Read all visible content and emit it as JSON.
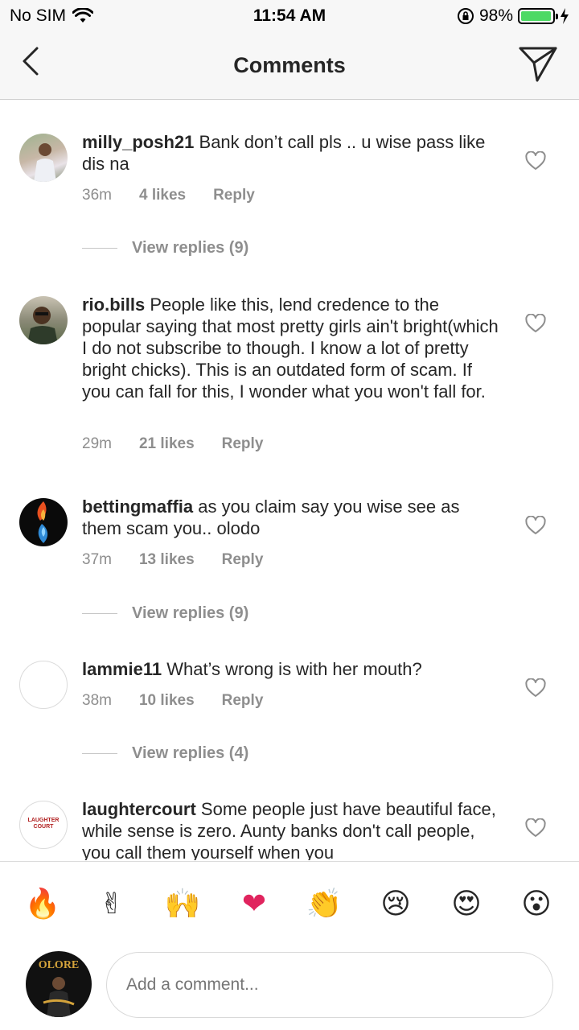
{
  "status_bar": {
    "carrier": "No SIM",
    "time": "11:54 AM",
    "battery": "98%",
    "battery_level": 0.98,
    "battery_color": "#4cd964"
  },
  "nav": {
    "title": "Comments",
    "back_icon": "chevron-left-icon",
    "send_icon": "paper-plane-icon"
  },
  "comments": [
    {
      "username": "milly_posh21",
      "text": "Bank don’t call pls .. u wise pass like dis na",
      "time": "36m",
      "likes": "4 likes",
      "reply": "Reply",
      "view_replies": "View replies (9)"
    },
    {
      "username": "rio.bills",
      "text": "People like this, lend credence to the popular saying that most pretty girls ain't bright(which I do not subscribe to though. I know a lot of pretty bright chicks). This is an outdated form of scam. If you can fall for this, I wonder what you won't fall for.",
      "time": "29m",
      "likes": "21 likes",
      "reply": "Reply"
    },
    {
      "username": "bettingmaffia",
      "text": "as you claim say you wise see as them scam you.. olodo",
      "time": "37m",
      "likes": "13 likes",
      "reply": "Reply",
      "view_replies": "View replies (9)"
    },
    {
      "username": "lammie11",
      "text": "What’s wrong is with her mouth?",
      "time": "38m",
      "likes": "10 likes",
      "reply": "Reply",
      "view_replies": "View replies (4)"
    },
    {
      "username": "laughtercourt",
      "text": "Some people just have beautiful face, while sense is zero. Aunty banks don't call people,  you call them yourself when you",
      "avatar_text": "LAUGHTER COURT"
    }
  ],
  "emoji_bar": [
    "🔥",
    "✌",
    "🙌",
    "❤",
    "👏",
    "😢",
    "😍",
    "😮"
  ],
  "composer": {
    "placeholder": "Add a comment...",
    "avatar_text": "OLORE"
  }
}
